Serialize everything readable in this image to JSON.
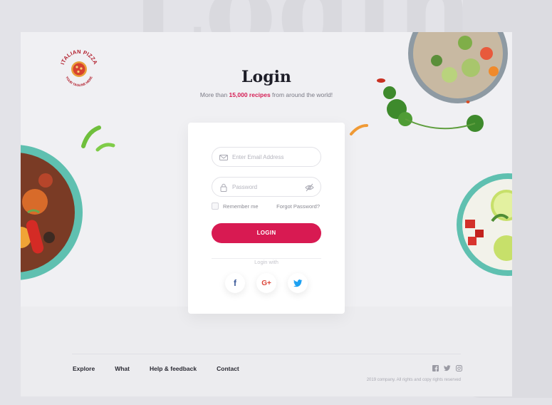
{
  "backdrop_word": "Login",
  "brand": {
    "name": "ITALIAN PIZZA",
    "tagline": "YOUR TAGLINE HERE"
  },
  "header": {
    "title": "Login",
    "subtitle_pre": "More than ",
    "subtitle_highlight": "15,000 recipes",
    "subtitle_post": " from around the world!"
  },
  "form": {
    "email_placeholder": "Enter Email Address",
    "password_placeholder": "Password",
    "remember_label": "Remember me",
    "forgot_label": "Forgot Password?",
    "login_label": "LOGIN",
    "divider_label": "Login with"
  },
  "social_login": [
    {
      "name": "facebook",
      "glyph": "f"
    },
    {
      "name": "google-plus",
      "glyph": "G+"
    },
    {
      "name": "twitter",
      "glyph": "t"
    }
  ],
  "footer": {
    "nav": [
      "Explore",
      "What",
      "Help & feedback",
      "Contact"
    ],
    "copyright": "2019 company. All rights and copy rights reserved"
  },
  "colors": {
    "accent": "#d81a52",
    "background": "#f0f0f3",
    "text_dark": "#1e1e28"
  }
}
